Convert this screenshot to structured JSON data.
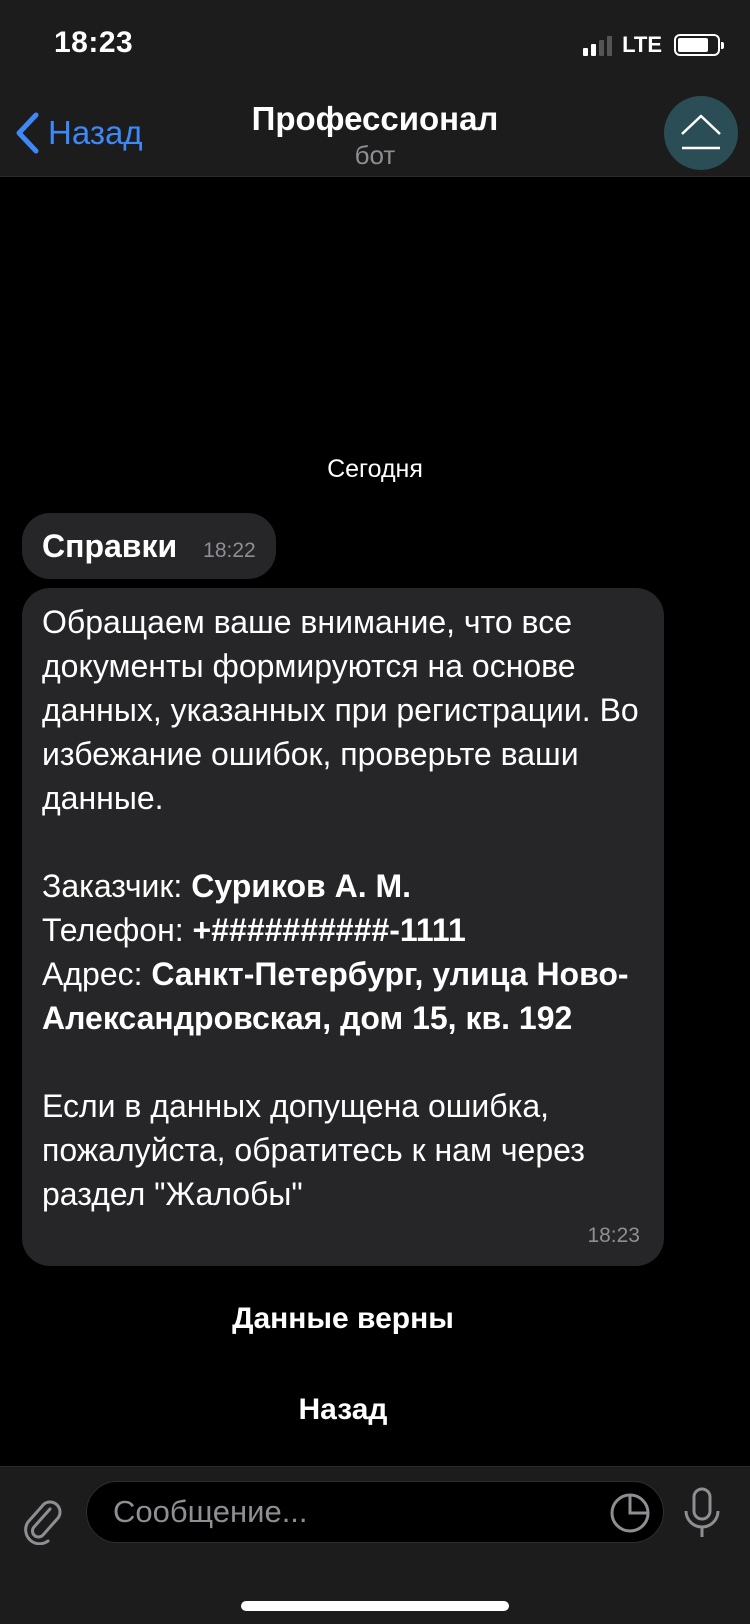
{
  "status_bar": {
    "time": "18:23",
    "network": "LTE",
    "battery_level": 0.8,
    "signal_bars": 2
  },
  "nav": {
    "back_label": "Назад",
    "title": "Профессионал",
    "subtitle": "бот",
    "accent_color": "#3e88f7"
  },
  "chat": {
    "date_label": "Сегодня",
    "messages": [
      {
        "text": "Справки",
        "time": "18:22"
      },
      {
        "intro": "Обращаем ваше внимание, что все документы формируются на основе данных, указанных при регистрации. Во избежание ошибок, проверьте ваши данные.",
        "customer_label": "Заказчик: ",
        "customer_value": "Суриков А. М.",
        "phone_label": "Телефон: ",
        "phone_value": "+##########-1111",
        "address_label": "Адрес: ",
        "address_value": "Санкт-Петербург, улица Ново-Александровская, дом 15, кв. 192",
        "outro": "Если в данных допущена ошибка, пожалуйста, обратитесь к нам через раздел \"Жалобы\"",
        "time": "18:23"
      }
    ]
  },
  "keyboard": {
    "buttons": [
      "Данные верны",
      "Назад"
    ]
  },
  "input": {
    "placeholder": "Сообщение...",
    "value": ""
  },
  "icons": {
    "back": "chevron-left-icon",
    "avatar": "bot-avatar-icon",
    "attach": "paperclip-icon",
    "sticker": "sticker-icon",
    "mic": "microphone-icon"
  }
}
